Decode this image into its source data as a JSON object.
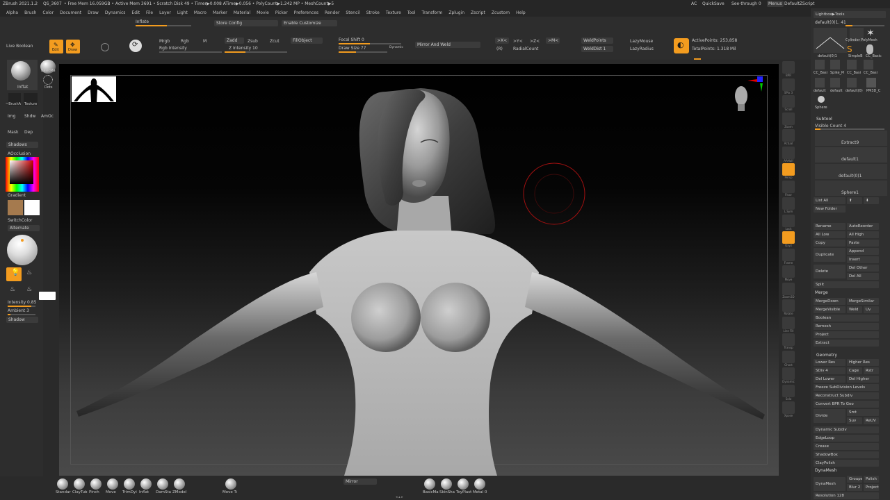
{
  "titlebar": {
    "app": "ZBrush 2021.1.2",
    "doc": "QS_3607",
    "stats": "• Free Mem 16.059GB • Active Mem 3691 • Scratch Disk 49 • Timer▶0.008 ATime▶0.056 • PolyCount▶1.242 MP • MeshCount▶5",
    "ac": "AC",
    "quicksave": "QuickSave",
    "seethrough": "See-through 0",
    "menus": "Menus",
    "script": "DefaultZScript"
  },
  "menubar": [
    "Alpha",
    "Brush",
    "Color",
    "Document",
    "Draw",
    "Dynamics",
    "Edit",
    "File",
    "Layer",
    "Light",
    "Macro",
    "Marker",
    "Material",
    "Movie",
    "Picker",
    "Preferences",
    "Render",
    "Stencil",
    "Stroke",
    "Texture",
    "Tool",
    "Transform",
    "Zplugin",
    "Zscript",
    "Zcustom",
    "Help"
  ],
  "topshelf": {
    "inflate": "Inflate",
    "store_config": "Store Config",
    "enable_customize": "Enable Customize",
    "live_boolean": "Live Boolean",
    "edit": "Edit",
    "draw": "Draw",
    "mrgb": "Mrgb",
    "rgb": "Rgb",
    "m": "M",
    "rgb_intensity": "Rgb Intensity",
    "zadd": "Zadd",
    "zsub": "Zsub",
    "zcut": "Zcut",
    "z_intensity": "Z Intensity 10",
    "fill_object": "FillObject",
    "focal_shift": "Focal Shift 0",
    "draw_size": "Draw Size 77",
    "dynamic": "Dynamic",
    "mirror_weld": "Mirror And Weld",
    "sym_x": ">X<",
    "sym_y": ">Y<",
    "sym_z": ">Z<",
    "sym_m": ">M<",
    "sym_r": "(R)",
    "radial_count": "RadialCount",
    "weld_points": "WeldPoints",
    "weld_dist": "WeldDist 1",
    "lazy_mouse": "LazyMouse",
    "lazy_radius": "LazyRadius",
    "active_points": "ActivePoints: 253,858",
    "total_points": "TotalPoints: 1.318 Mil"
  },
  "leftshelf": {
    "brush": "Inflat",
    "basic_material": "BasicMa",
    "dots": "Dots",
    "brush_alpha": "~BrushA",
    "texture": "Texture",
    "img": "Img",
    "shdw": "Shdw",
    "amoc": "AmOc",
    "mask": "Mask",
    "dep": "Dep",
    "shadows": "Shadows",
    "aocclusion": "AOcclusion",
    "gradient": "Gradient",
    "switch_color": "SwitchColor",
    "alternate": "Alternate",
    "intensity": "Intensity 0.85",
    "ambient": "Ambient 3",
    "shadow": "Shadow",
    "main_color": "#a57a4e",
    "secondary_color": "#ffffff"
  },
  "rightstrip": [
    {
      "label": "BPR",
      "icon": "bpr-icon"
    },
    {
      "label": "SPix 3",
      "icon": "spix-icon"
    },
    {
      "label": "Scroll",
      "icon": "scroll-icon"
    },
    {
      "label": "Zoom",
      "icon": "zoom-icon"
    },
    {
      "label": "Actual",
      "icon": "actual-icon"
    },
    {
      "label": "AAHalf",
      "icon": "aahalf-icon"
    },
    {
      "label": "Persp",
      "icon": "persp-icon"
    },
    {
      "label": "Floor",
      "icon": "floor-icon"
    },
    {
      "label": "L.Sym",
      "icon": "lsym-icon"
    },
    {
      "label": "Lock",
      "icon": "lock-icon"
    },
    {
      "label": "Qxyz",
      "icon": "qxyz-icon"
    },
    {
      "label": "Frame",
      "icon": "frame-icon"
    },
    {
      "label": "Move",
      "icon": "move-icon"
    },
    {
      "label": "Zoom3D",
      "icon": "zoom3d-icon"
    },
    {
      "label": "Rotate",
      "icon": "rotate-icon"
    },
    {
      "label": "Line Fill",
      "icon": "linefill-icon"
    },
    {
      "label": "Transp",
      "icon": "transp-icon"
    },
    {
      "label": "Ghost",
      "icon": "ghost-icon"
    },
    {
      "label": "Dynamic",
      "icon": "dynamic-icon"
    },
    {
      "label": "Solo",
      "icon": "solo-icon"
    },
    {
      "label": "Xpose",
      "icon": "xpose-icon"
    }
  ],
  "rightpanel": {
    "lightbox": "Lightbox▶Tools",
    "current_tool": "default(0)1. 41",
    "tools": [
      "default(0)1",
      "Cylinder PolyMesh",
      "SimpleB",
      "CC_Basic",
      "CC_Basi",
      "Spike_Pi",
      "CC_Basi",
      "CC_Basi",
      "default",
      "default",
      "default(0)",
      "PM3D_C",
      "Sphere"
    ],
    "subtool": "Subtool",
    "visible_count": "Visible Count 4",
    "subtools": [
      "Extract9",
      "default1",
      "default(0)1",
      "Sphere1"
    ],
    "list_all": "List All",
    "new_folder": "New Folder",
    "rename": "Rename",
    "autoreorder": "AutoReorder",
    "all_low": "All Low",
    "all_high": "All High",
    "copy": "Copy",
    "paste": "Paste",
    "duplicate": "Duplicate",
    "append": "Append",
    "insert": "Insert",
    "delete": "Delete",
    "del_other": "Del Other",
    "del_all": "Del All",
    "split": "Split",
    "merge": "Merge",
    "merge_down": "MergeDown",
    "merge_similar": "MergeSimilar",
    "merge_visible": "MergeVisible",
    "weld": "Weld",
    "uv": "Uv",
    "boolean": "Boolean",
    "remesh": "Remesh",
    "project": "Project",
    "extract": "Extract",
    "geometry": "Geometry",
    "lower_res": "Lower Res",
    "higher_res": "Higher Res",
    "sdiv": "SDiv 4",
    "cage": "Cage",
    "rstr": "Rstr",
    "del_lower": "Del Lower",
    "del_higher": "Del Higher",
    "freeze_subdiv": "Freeze SubDivision Levels",
    "reconstruct_subdiv": "Reconstruct Subdiv",
    "convert_bpr": "Convert BPR To Geo",
    "divide": "Divide",
    "smt": "Smt",
    "suv": "Suv",
    "reuv": "ReUV",
    "dynamic_subdiv": "Dynamic Subdiv",
    "edgeloop": "EdgeLoop",
    "crease": "Crease",
    "shadowbox": "ShadowBox",
    "claypolish": "ClayPolish",
    "dynamesh_head": "DynaMesh",
    "dynamesh": "DynaMesh",
    "groups": "Groups",
    "polish": "Polish",
    "blur": "Blur 2",
    "project2": "Project",
    "resolution": "Resolution 128"
  },
  "bottombar": {
    "brushes": [
      "Standar",
      "ClayTub",
      "Pinch",
      "Move",
      "TrimDyi",
      "Inflat",
      "DamSta",
      "ZModel"
    ],
    "move_t": "Move Tı",
    "mirror": "Mirror",
    "materials": [
      "BasicMa",
      "SkinSha",
      "ToyPlast",
      "Metal 0"
    ]
  }
}
